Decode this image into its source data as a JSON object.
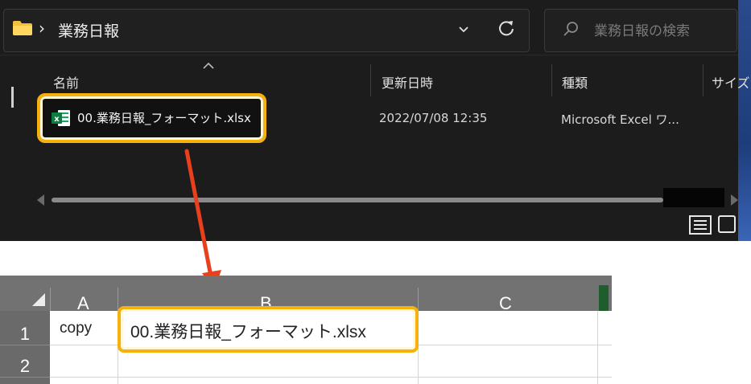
{
  "explorer": {
    "breadcrumb_path": "業務日報",
    "search_placeholder": "業務日報の検索",
    "columns": {
      "name": "名前",
      "modified": "更新日時",
      "type": "種類",
      "size": "サイズ"
    },
    "file": {
      "name": "00.業務日報_フォーマット.xlsx",
      "modified": "2022/07/08 12:35",
      "type": "Microsoft Excel ワ..."
    },
    "highlight_color": "#f6b10e",
    "background_color": "#1c1c1c"
  },
  "excel": {
    "columns": [
      "A",
      "B",
      "C"
    ],
    "rows": [
      "1",
      "2"
    ],
    "cell_a1": "copy",
    "cell_b1": "00.業務日報_フォーマット.xlsx",
    "header_color": "#727272"
  },
  "annotation": {
    "arrow_color": "#e8401c"
  }
}
